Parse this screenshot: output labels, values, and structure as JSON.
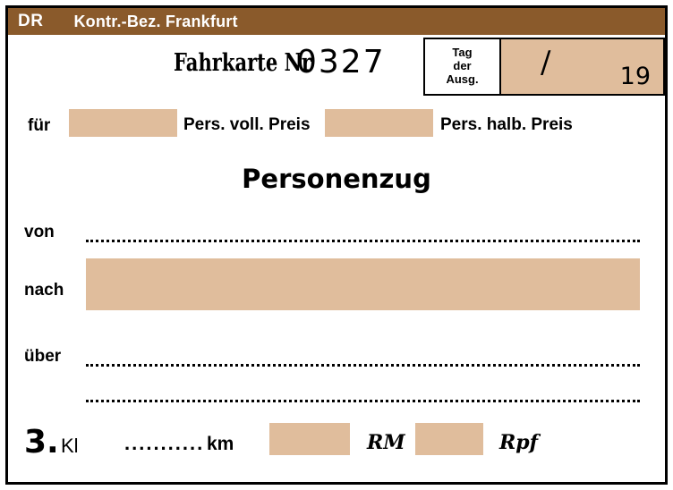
{
  "ticket": {
    "header": {
      "railway_code": "DR",
      "district": "Kontr.-Bez. Frankfurt",
      "background_color": "#8a5a2b",
      "text_color": "#ffffff"
    },
    "title": {
      "label": "Fahrkarte Nr",
      "number": "0327"
    },
    "issue_box": {
      "line1": "Tag",
      "line2": "der",
      "line3": "Ausg.",
      "separator": "/",
      "year_prefix": "19",
      "fill_color": "#e0bd9c"
    },
    "passenger_row": {
      "fuer_label": "für",
      "full_fare_label": "Pers. voll. Preis",
      "half_fare_label": "Pers. halb. Preis"
    },
    "train_type": "Personenzug",
    "route": {
      "from_label": "von",
      "to_label": "nach",
      "via_label": "über"
    },
    "footer": {
      "class_number": "3.",
      "class_label": "Kl",
      "km_dots": "...........",
      "km_label": "km",
      "currency_mark": "RM",
      "currency_pfennig": "Rpf"
    },
    "colors": {
      "fill": "#e0bd9c",
      "frame": "#000000",
      "header": "#8a5a2b"
    }
  }
}
